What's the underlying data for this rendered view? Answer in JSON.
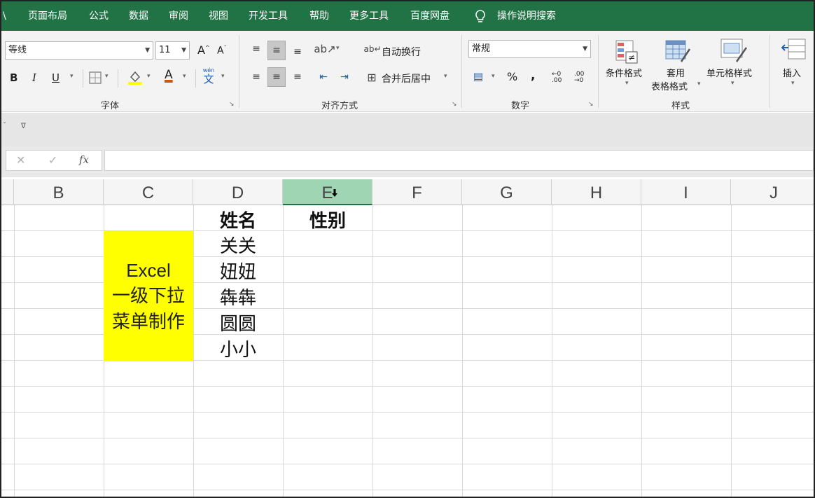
{
  "menu": {
    "items": [
      "\\",
      "页面布局",
      "公式",
      "数据",
      "审阅",
      "视图",
      "开发工具",
      "帮助",
      "更多工具",
      "百度网盘"
    ],
    "search": "操作说明搜索"
  },
  "ribbon": {
    "font_name": "等线",
    "font_size": "11",
    "grow_font": "A",
    "shrink_font": "A",
    "bold": "B",
    "italic": "I",
    "underline": "U",
    "font_color_letter": "A",
    "wen": "wén",
    "wen_char": "文",
    "font_group": "字体",
    "wrap_text": "自动换行",
    "merge_center": "合并后居中",
    "alignment_group": "对齐方式",
    "number_format": "常规",
    "percent": "%",
    "comma": ",",
    "inc_decimal": "←0 .00",
    "dec_decimal": ".00 →0",
    "number_group": "数字",
    "conditional_format": "条件格式",
    "table_format_1": "套用",
    "table_format_2": "表格格式",
    "cell_styles": "单元格样式",
    "styles_group": "样式",
    "insert": "插入",
    "colors": {
      "fill": "#ffff00",
      "font": "#c55a11"
    }
  },
  "formula_bar": {
    "cancel": "✕",
    "enter": "✓",
    "fx": "fx",
    "content": ""
  },
  "columns": [
    "B",
    "C",
    "D",
    "E",
    "F",
    "G",
    "H",
    "I",
    "J"
  ],
  "active_column": "E",
  "cells": {
    "d1": "姓名",
    "e1": "性别",
    "names": [
      "关关",
      "妞妞",
      "犇犇",
      "圆圆",
      "小小"
    ],
    "c_text": [
      "Excel",
      "一级下拉",
      "菜单制作"
    ]
  },
  "colors": {
    "accent": "#217346",
    "highlight": "#ffff00",
    "active_col": "#9fd5b3"
  }
}
